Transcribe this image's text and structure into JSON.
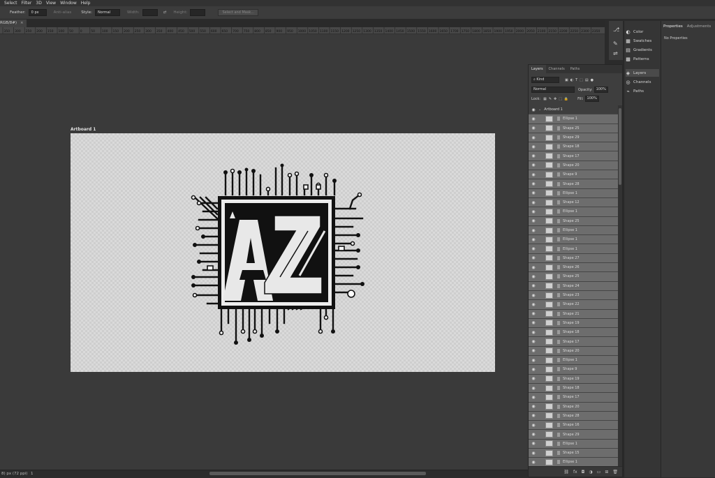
{
  "menu": [
    "Select",
    "Filter",
    "3D",
    "View",
    "Window",
    "Help"
  ],
  "options": {
    "feather_label": "Feather:",
    "feather_value": "0 px",
    "antialias_label": "Anti-alias",
    "style_label": "Style:",
    "style_value": "Normal",
    "width_label": "Width:",
    "height_label": "Height:",
    "mask_button": "Select and Mask..."
  },
  "doc_tab": "RGB/8#)",
  "ruler_ticks": [
    "350",
    "300",
    "250",
    "200",
    "150",
    "100",
    "50",
    "0",
    "50",
    "100",
    "150",
    "200",
    "250",
    "300",
    "350",
    "400",
    "450",
    "500",
    "550",
    "600",
    "650",
    "700",
    "750",
    "800",
    "850",
    "900",
    "950",
    "1000",
    "1050",
    "1100",
    "1150",
    "1200",
    "1250",
    "1300",
    "1350",
    "1400",
    "1450",
    "1500",
    "1550",
    "1600",
    "1650",
    "1700",
    "1750",
    "1800",
    "1850",
    "1900",
    "1950",
    "2000",
    "2050",
    "2100",
    "2150",
    "2200",
    "2250",
    "2300",
    "2350"
  ],
  "artboard_label": "Artboard 1",
  "status": {
    "zoom": "8) px (72 ppi)",
    "page": "1"
  },
  "side_panels": [
    {
      "label": "Color",
      "icon": "color-wheel-icon"
    },
    {
      "label": "Swatches",
      "icon": "swatches-icon"
    },
    {
      "label": "Gradients",
      "icon": "gradients-icon"
    },
    {
      "label": "Patterns",
      "icon": "patterns-icon"
    },
    {
      "label": "Layers",
      "icon": "layers-icon"
    },
    {
      "label": "Channels",
      "icon": "channels-icon"
    },
    {
      "label": "Paths",
      "icon": "paths-icon"
    }
  ],
  "properties": {
    "tab1": "Properties",
    "tab2": "Adjustments",
    "empty": "No Properties"
  },
  "layers_panel": {
    "tabs": [
      "Layers",
      "Channels",
      "Paths"
    ],
    "filter_kind": "Kind",
    "blend_mode": "Normal",
    "opacity_label": "Opacity:",
    "opacity_value": "100%",
    "lock_label": "Lock:",
    "fill_label": "Fill:",
    "fill_value": "100%",
    "group_name": "Artboard 1",
    "layers": [
      "Ellipse 1",
      "Shape 25",
      "Shape 29",
      "Shape 18",
      "Shape 17",
      "Shape 20",
      "Shape 9",
      "Shape 28",
      "Ellipse 1",
      "Shape 12",
      "Ellipse 1",
      "Shape 25",
      "Ellipse 1",
      "Ellipse 1",
      "Ellipse 1",
      "Shape 27",
      "Shape 26",
      "Shape 25",
      "Shape 24",
      "Shape 23",
      "Shape 22",
      "Shape 21",
      "Shape 19",
      "Shape 18",
      "Shape 17",
      "Shape 20",
      "Ellipse 1",
      "Shape 9",
      "Shape 19",
      "Shape 18",
      "Shape 17",
      "Shape 20",
      "Shape 28",
      "Shape 16",
      "Shape 29",
      "Ellipse 1",
      "Shape 15",
      "Ellipse 1"
    ]
  }
}
